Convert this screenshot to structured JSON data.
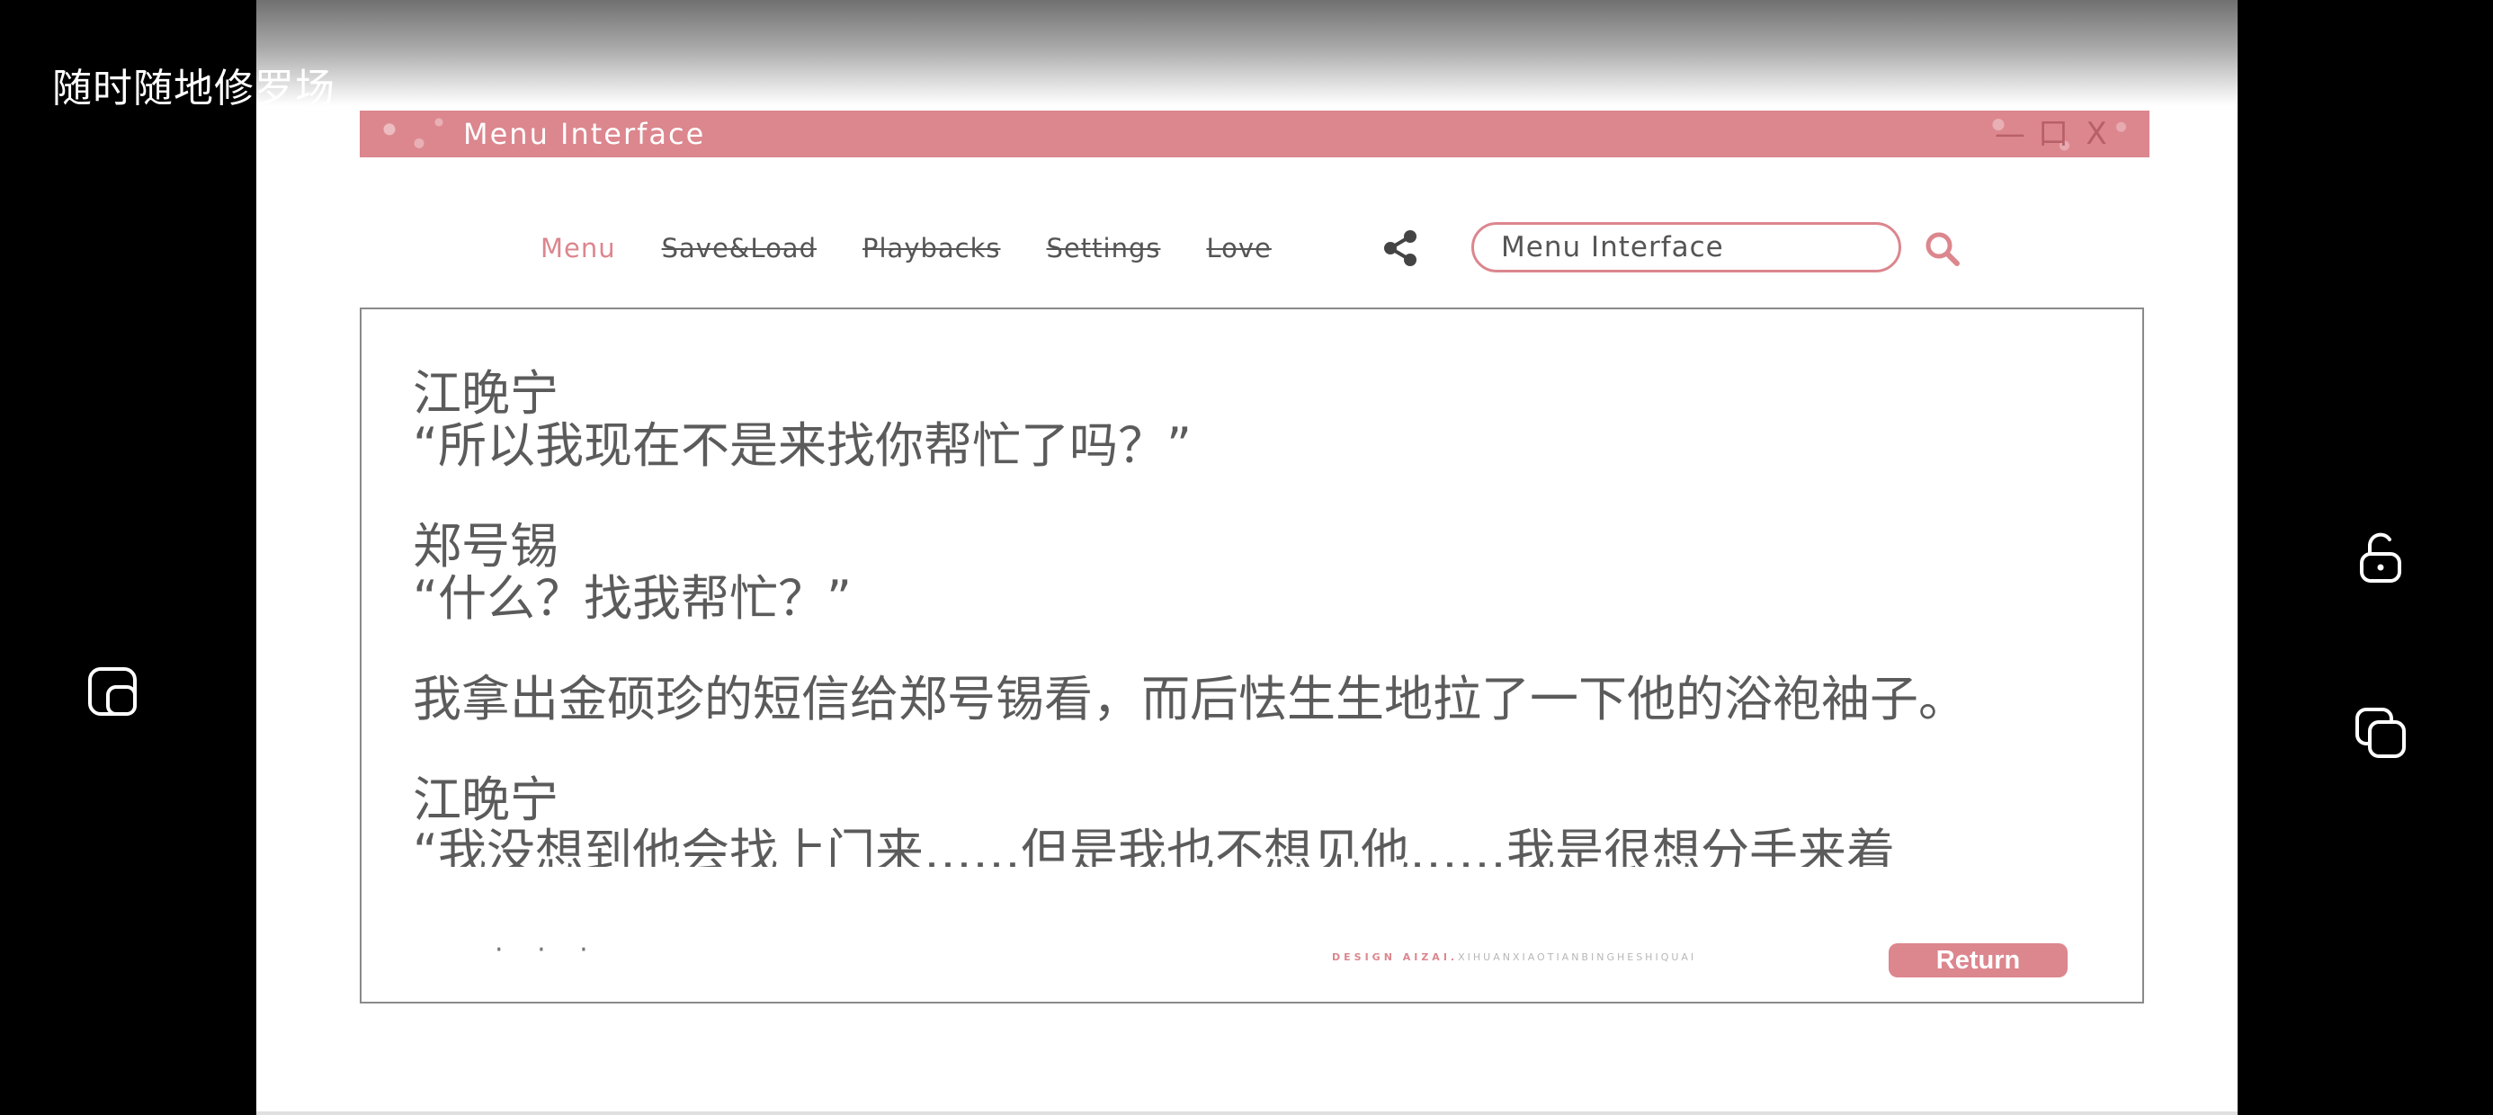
{
  "overlay": {
    "caption": "随时随地修罗场"
  },
  "window": {
    "title": "Menu Interface",
    "controls": [
      "—",
      "口",
      "X"
    ]
  },
  "nav": {
    "items": [
      {
        "label": "Menu",
        "active": true
      },
      {
        "label": "Save&Load",
        "active": false
      },
      {
        "label": "Playbacks",
        "active": false
      },
      {
        "label": "Settings",
        "active": false
      },
      {
        "label": "Love",
        "active": false
      }
    ]
  },
  "search": {
    "value": "Menu Interface"
  },
  "dialogue": {
    "blocks": [
      {
        "speaker": "江晚宁",
        "line": "“所以我现在不是来找你帮忙了吗？”"
      },
      {
        "speaker": "郑号锡",
        "line": "“什么？找我帮忙？”"
      },
      {
        "speaker": "",
        "line": "我拿出金硕珍的短信给郑号锡看，而后怯生生地拉了一下他的浴袍袖子。"
      },
      {
        "speaker": "江晚宁",
        "line": "“我没想到他会找上门来……但是我也不想见他……我是很想分手来着"
      }
    ]
  },
  "footer": {
    "dots": "· · ·",
    "design_label": "DESIGN AIZAI.",
    "design_sub": "XIHUANXIAOTIANBINGHESHIQUAI",
    "return_label": "Return"
  },
  "colors": {
    "accent": "#dc868e",
    "text": "#5b5b5b"
  },
  "side_icons": {
    "left": "screenshot-icon",
    "right_top": "unlock-icon",
    "right_bottom": "window-switch-icon"
  }
}
